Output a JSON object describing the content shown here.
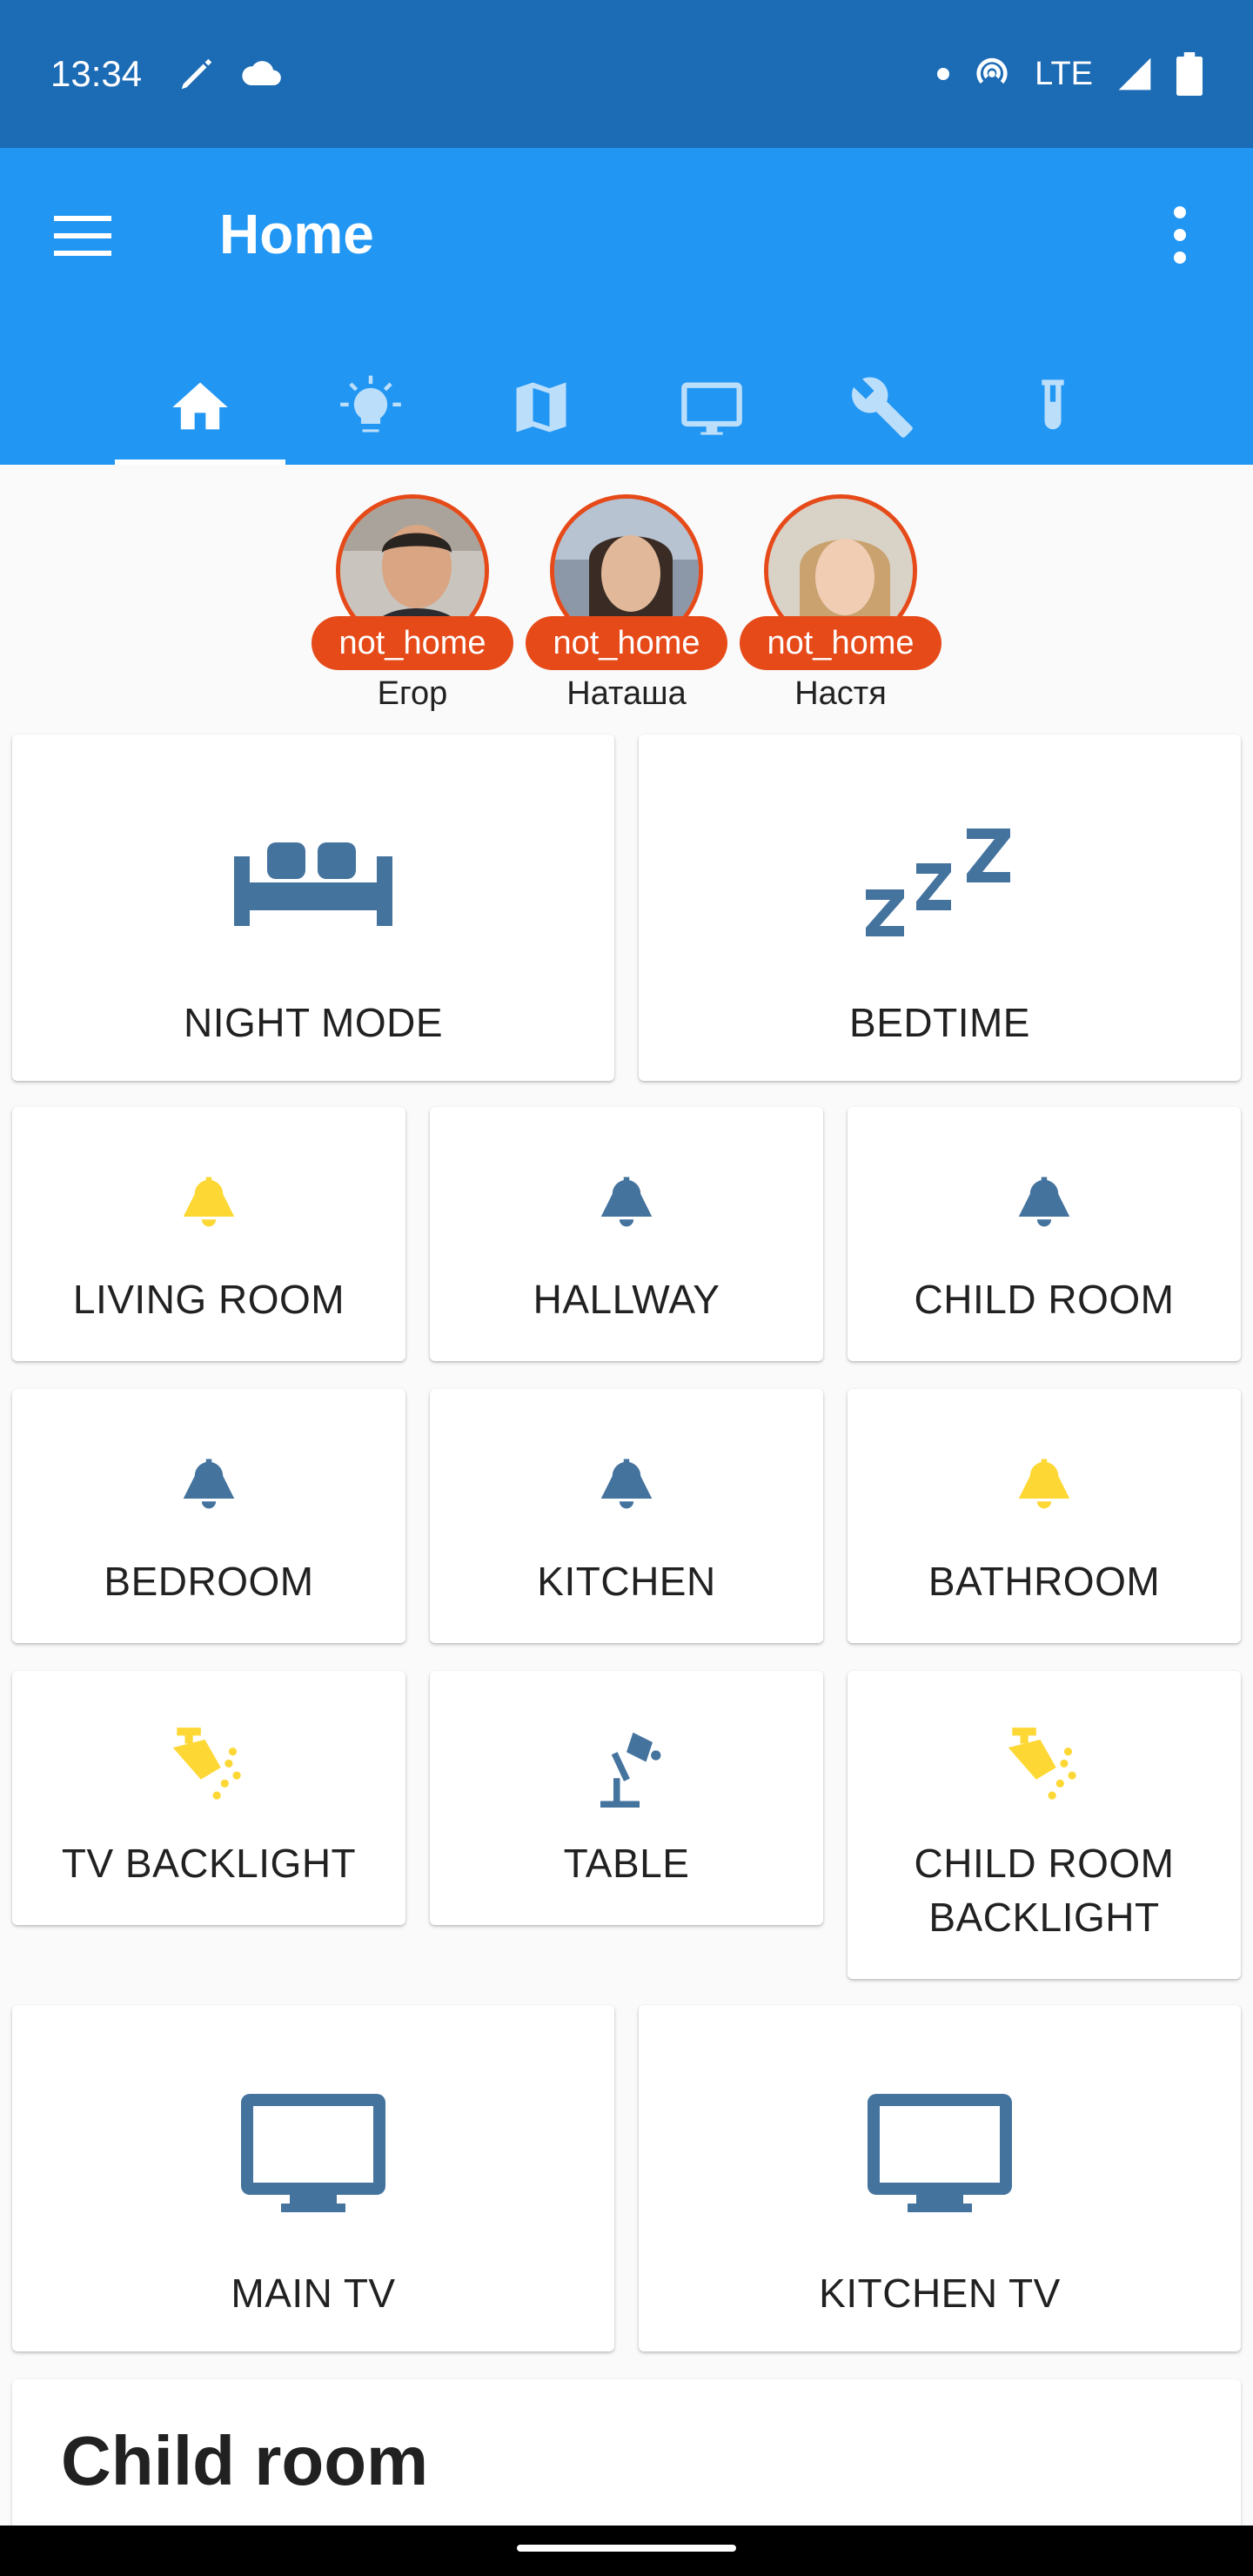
{
  "status_bar": {
    "time": "13:34",
    "network": "LTE",
    "icons": [
      "pen-icon",
      "cloud-icon",
      "dot-icon",
      "hotspot-icon",
      "signal-icon",
      "battery-icon"
    ]
  },
  "toolbar": {
    "title": "Home",
    "menu_icon": "hamburger-icon",
    "overflow_icon": "more-vert-icon",
    "tabs": [
      {
        "icon": "home-icon",
        "active": true
      },
      {
        "icon": "lightbulb-icon",
        "active": false
      },
      {
        "icon": "map-icon",
        "active": false
      },
      {
        "icon": "monitor-icon",
        "active": false
      },
      {
        "icon": "wrench-icon",
        "active": false
      },
      {
        "icon": "flask-icon",
        "active": false
      }
    ]
  },
  "persons": [
    {
      "name": "Егор",
      "state": "not_home"
    },
    {
      "name": "Наташа",
      "state": "not_home"
    },
    {
      "name": "Настя",
      "state": "not_home"
    }
  ],
  "scenes": [
    {
      "label": "NIGHT MODE",
      "icon": "sofa-icon"
    },
    {
      "label": "BEDTIME",
      "icon": "sleep-zzz-icon"
    }
  ],
  "lights": [
    {
      "label": "LIVING ROOM",
      "icon": "ceiling-light-icon",
      "on": true
    },
    {
      "label": "HALLWAY",
      "icon": "ceiling-light-icon",
      "on": false
    },
    {
      "label": "CHILD ROOM",
      "icon": "ceiling-light-icon",
      "on": false
    },
    {
      "label": "BEDROOM",
      "icon": "ceiling-light-icon",
      "on": false
    },
    {
      "label": "KITCHEN",
      "icon": "ceiling-light-icon",
      "on": false
    },
    {
      "label": "BATHROOM",
      "icon": "ceiling-light-icon",
      "on": true
    },
    {
      "label": "TV BACKLIGHT",
      "icon": "spotlight-icon",
      "on": true
    },
    {
      "label": "TABLE",
      "icon": "desk-lamp-icon",
      "on": false
    },
    {
      "label": "CHILD ROOM BACKLIGHT",
      "icon": "spotlight-icon",
      "on": true
    }
  ],
  "media": [
    {
      "label": "MAIN TV",
      "icon": "tv-icon"
    },
    {
      "label": "KITCHEN TV",
      "icon": "tv-icon"
    }
  ],
  "section": {
    "title": "Child room"
  },
  "colors": {
    "status_bar": "#1b6bb5",
    "toolbar": "#2196f3",
    "icon_off": "#44739e",
    "icon_on": "#fdd835",
    "badge": "#e64a19"
  }
}
